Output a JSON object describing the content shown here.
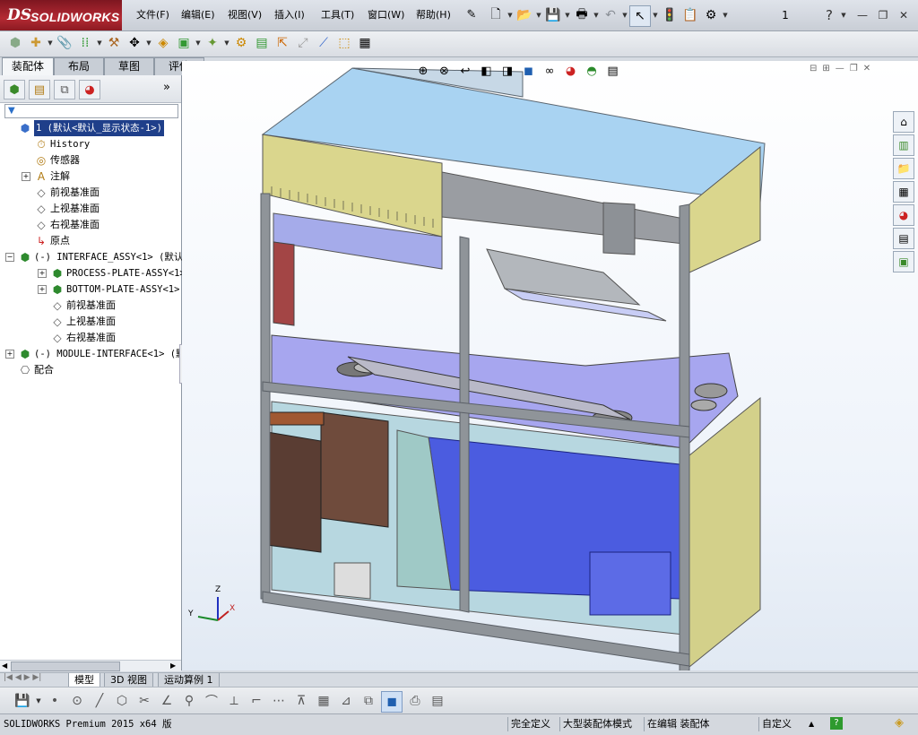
{
  "app": {
    "logo_ds": "DS",
    "logo_text": "SOLIDWORKS",
    "menu": [
      "文件(F)",
      "编辑(E)",
      "视图(V)",
      "插入(I)",
      "工具(T)",
      "窗口(W)",
      "帮助(H)"
    ],
    "page_indicator": "1",
    "help_symbol": "?"
  },
  "command_tabs": [
    "装配体",
    "布局",
    "草图",
    "评估"
  ],
  "feature_manager": {
    "filter_symbol": "▼",
    "tree": [
      {
        "label": "1  (默认<默认_显示状态-1>)",
        "icon": "assembly-icon",
        "selected": true
      },
      {
        "label": "History",
        "icon": "history-icon"
      },
      {
        "label": "传感器",
        "icon": "sensor-icon"
      },
      {
        "label": "注解",
        "icon": "annotation-icon"
      },
      {
        "label": "前视基准面",
        "icon": "plane-icon"
      },
      {
        "label": "上视基准面",
        "icon": "plane-icon"
      },
      {
        "label": "右视基准面",
        "icon": "plane-icon"
      },
      {
        "label": "原点",
        "icon": "origin-icon"
      },
      {
        "label": "(-) INTERFACE_ASSY<1> (默认",
        "icon": "subassembly-icon"
      },
      {
        "label": "PROCESS-PLATE-ASSY<1> (",
        "icon": "subassembly-icon"
      },
      {
        "label": "BOTTOM-PLATE-ASSY<1> (默",
        "icon": "subassembly-icon"
      },
      {
        "label": "前视基准面",
        "icon": "plane-icon"
      },
      {
        "label": "上视基准面",
        "icon": "plane-icon"
      },
      {
        "label": "右视基准面",
        "icon": "plane-icon"
      },
      {
        "label": "(-) MODULE-INTERFACE<1> (默",
        "icon": "subassembly-icon"
      },
      {
        "label": "配合",
        "icon": "mates-icon"
      }
    ]
  },
  "triad": {
    "x": "X",
    "y": "Y",
    "z": "Z"
  },
  "bottom_tabs": [
    "模型",
    "3D 视图",
    "运动算例 1"
  ],
  "status": {
    "product": "SOLIDWORKS Premium 2015 x64 版",
    "definition": "完全定义",
    "mode": "大型装配体模式",
    "editing": "在编辑 装配体",
    "units": "自定义",
    "arrow": "▲"
  },
  "colors": {
    "accent": "#b42a33",
    "selection": "#1f3f8a",
    "frame_gray": "#8f9499",
    "panel_yellow": "#d8d58a",
    "top_blue": "#a9d3f2",
    "plate_purple": "#a7a6ef",
    "module_blue": "#4c5be0"
  }
}
